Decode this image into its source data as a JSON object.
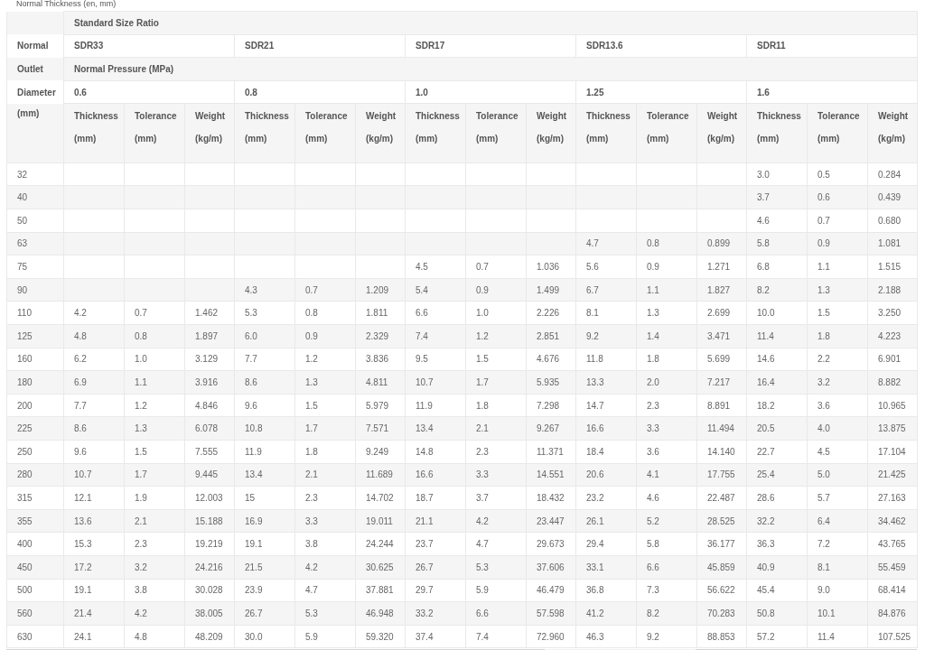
{
  "title": "Normal Thickness (en, mm)",
  "header": {
    "group_label": "Standard Size Ratio",
    "pressure_label": "Normal Pressure (MPa)",
    "first_column": [
      "Normal",
      "Outlet",
      "Diameter",
      "(mm)"
    ],
    "sdrs": [
      "SDR33",
      "SDR21",
      "SDR17",
      "SDR13.6",
      "SDR11"
    ],
    "pressures": [
      "0.6",
      "0.8",
      "1.0",
      "1.25",
      "1.6"
    ],
    "subheaders": [
      "Thickness (mm)",
      "Tolerance (mm)",
      "Weight (kg/m)",
      "Thickness (mm)",
      "Tolerance (mm)",
      "Weight (kg/m)",
      "Thickness (mm)",
      "Tolerance (mm)",
      "Weight (kg/m)",
      "Thickness (mm)",
      "Tolerance (mm)",
      "Weight (kg/m)",
      "Thickness (mm)",
      "Tolerance (mm)",
      "Weight (kg/m)"
    ]
  },
  "rows": [
    {
      "diameter": "32",
      "sdr11": [
        "3.0",
        "0.5",
        "0.284"
      ]
    },
    {
      "diameter": "40",
      "sdr11": [
        "3.7",
        "0.6",
        "0.439"
      ]
    },
    {
      "diameter": "50",
      "sdr11": [
        "4.6",
        "0.7",
        "0.680"
      ]
    },
    {
      "diameter": "63",
      "sdr13_6": [
        "4.7",
        "0.8",
        "0.899"
      ],
      "sdr11": [
        "5.8",
        "0.9",
        "1.081"
      ]
    },
    {
      "diameter": "75",
      "sdr17": [
        "4.5",
        "0.7",
        "1.036"
      ],
      "sdr13_6": [
        "5.6",
        "0.9",
        "1.271"
      ],
      "sdr11": [
        "6.8",
        "1.1",
        "1.515"
      ]
    },
    {
      "diameter": "90",
      "sdr21": [
        "4.3",
        "0.7",
        "1.209"
      ],
      "sdr17": [
        "5.4",
        "0.9",
        "1.499"
      ],
      "sdr13_6": [
        "6.7",
        "1.1",
        "1.827"
      ],
      "sdr11": [
        "8.2",
        "1.3",
        "2.188"
      ]
    },
    {
      "diameter": "110",
      "sdr33": [
        "4.2",
        "0.7",
        "1.462"
      ],
      "sdr21": [
        "5.3",
        "0.8",
        "1.811"
      ],
      "sdr17": [
        "6.6",
        "1.0",
        "2.226"
      ],
      "sdr13_6": [
        "8.1",
        "1.3",
        "2.699"
      ],
      "sdr11": [
        "10.0",
        "1.5",
        "3.250"
      ]
    },
    {
      "diameter": "125",
      "sdr33": [
        "4.8",
        "0.8",
        "1.897"
      ],
      "sdr21": [
        "6.0",
        "0.9",
        "2.329"
      ],
      "sdr17": [
        "7.4",
        "1.2",
        "2.851"
      ],
      "sdr13_6": [
        "9.2",
        "1.4",
        "3.471"
      ],
      "sdr11": [
        "11.4",
        "1.8",
        "4.223"
      ]
    },
    {
      "diameter": "160",
      "sdr33": [
        "6.2",
        "1.0",
        "3.129"
      ],
      "sdr21": [
        "7.7",
        "1.2",
        "3.836"
      ],
      "sdr17": [
        "9.5",
        "1.5",
        "4.676"
      ],
      "sdr13_6": [
        "11.8",
        "1.8",
        "5.699"
      ],
      "sdr11": [
        "14.6",
        "2.2",
        "6.901"
      ]
    },
    {
      "diameter": "180",
      "sdr33": [
        "6.9",
        "1.1",
        "3.916"
      ],
      "sdr21": [
        "8.6",
        "1.3",
        "4.811"
      ],
      "sdr17": [
        "10.7",
        "1.7",
        "5.935"
      ],
      "sdr13_6": [
        "13.3",
        "2.0",
        "7.217"
      ],
      "sdr11": [
        "16.4",
        "3.2",
        "8.882"
      ]
    },
    {
      "diameter": "200",
      "sdr33": [
        "7.7",
        "1.2",
        "4.846"
      ],
      "sdr21": [
        "9.6",
        "1.5",
        "5.979"
      ],
      "sdr17": [
        "11.9",
        "1.8",
        "7.298"
      ],
      "sdr13_6": [
        "14.7",
        "2.3",
        "8.891"
      ],
      "sdr11": [
        "18.2",
        "3.6",
        "10.965"
      ]
    },
    {
      "diameter": "225",
      "sdr33": [
        "8.6",
        "1.3",
        "6.078"
      ],
      "sdr21": [
        "10.8",
        "1.7",
        "7.571"
      ],
      "sdr17": [
        "13.4",
        "2.1",
        "9.267"
      ],
      "sdr13_6": [
        "16.6",
        "3.3",
        "11.494"
      ],
      "sdr11": [
        "20.5",
        "4.0",
        "13.875"
      ]
    },
    {
      "diameter": "250",
      "sdr33": [
        "9.6",
        "1.5",
        "7.555"
      ],
      "sdr21": [
        "11.9",
        "1.8",
        "9.249"
      ],
      "sdr17": [
        "14.8",
        "2.3",
        "11.371"
      ],
      "sdr13_6": [
        "18.4",
        "3.6",
        "14.140"
      ],
      "sdr11": [
        "22.7",
        "4.5",
        "17.104"
      ]
    },
    {
      "diameter": "280",
      "sdr33": [
        "10.7",
        "1.7",
        "9.445"
      ],
      "sdr21": [
        "13.4",
        "2.1",
        "11.689"
      ],
      "sdr17": [
        "16.6",
        "3.3",
        "14.551"
      ],
      "sdr13_6": [
        "20.6",
        "4.1",
        "17.755"
      ],
      "sdr11": [
        "25.4",
        "5.0",
        "21.425"
      ]
    },
    {
      "diameter": "315",
      "sdr33": [
        "12.1",
        "1.9",
        "12.003"
      ],
      "sdr21": [
        "15",
        "2.3",
        "14.702"
      ],
      "sdr17": [
        "18.7",
        "3.7",
        "18.432"
      ],
      "sdr13_6": [
        "23.2",
        "4.6",
        "22.487"
      ],
      "sdr11": [
        "28.6",
        "5.7",
        "27.163"
      ]
    },
    {
      "diameter": "355",
      "sdr33": [
        "13.6",
        "2.1",
        "15.188"
      ],
      "sdr21": [
        "16.9",
        "3.3",
        "19.011"
      ],
      "sdr17": [
        "21.1",
        "4.2",
        "23.447"
      ],
      "sdr13_6": [
        "26.1",
        "5.2",
        "28.525"
      ],
      "sdr11": [
        "32.2",
        "6.4",
        "34.462"
      ]
    },
    {
      "diameter": "400",
      "sdr33": [
        "15.3",
        "2.3",
        "19.219"
      ],
      "sdr21": [
        "19.1",
        "3.8",
        "24.244"
      ],
      "sdr17": [
        "23.7",
        "4.7",
        "29.673"
      ],
      "sdr13_6": [
        "29.4",
        "5.8",
        "36.177"
      ],
      "sdr11": [
        "36.3",
        "7.2",
        "43.765"
      ]
    },
    {
      "diameter": "450",
      "sdr33": [
        "17.2",
        "3.2",
        "24.216"
      ],
      "sdr21": [
        "21.5",
        "4.2",
        "30.625"
      ],
      "sdr17": [
        "26.7",
        "5.3",
        "37.606"
      ],
      "sdr13_6": [
        "33.1",
        "6.6",
        "45.859"
      ],
      "sdr11": [
        "40.9",
        "8.1",
        "55.459"
      ]
    },
    {
      "diameter": "500",
      "sdr33": [
        "19.1",
        "3.8",
        "30.028"
      ],
      "sdr21": [
        "23.9",
        "4.7",
        "37.881"
      ],
      "sdr17": [
        "29.7",
        "5.9",
        "46.479"
      ],
      "sdr13_6": [
        "36.8",
        "7.3",
        "56.622"
      ],
      "sdr11": [
        "45.4",
        "9.0",
        "68.414"
      ]
    },
    {
      "diameter": "560",
      "sdr33": [
        "21.4",
        "4.2",
        "38.005"
      ],
      "sdr21": [
        "26.7",
        "5.3",
        "46.948"
      ],
      "sdr17": [
        "33.2",
        "6.6",
        "57.598"
      ],
      "sdr13_6": [
        "41.2",
        "8.2",
        "70.283"
      ],
      "sdr11": [
        "50.8",
        "10.1",
        "84.876"
      ]
    },
    {
      "diameter": "630",
      "sdr33": [
        "24.1",
        "4.8",
        "48.209"
      ],
      "sdr21": [
        "30.0",
        "5.9",
        "59.320"
      ],
      "sdr17": [
        "37.4",
        "7.4",
        "72.960"
      ],
      "sdr13_6": [
        "46.3",
        "9.2",
        "88.853"
      ],
      "sdr11": [
        "57.2",
        "11.4",
        "107.525"
      ]
    }
  ]
}
